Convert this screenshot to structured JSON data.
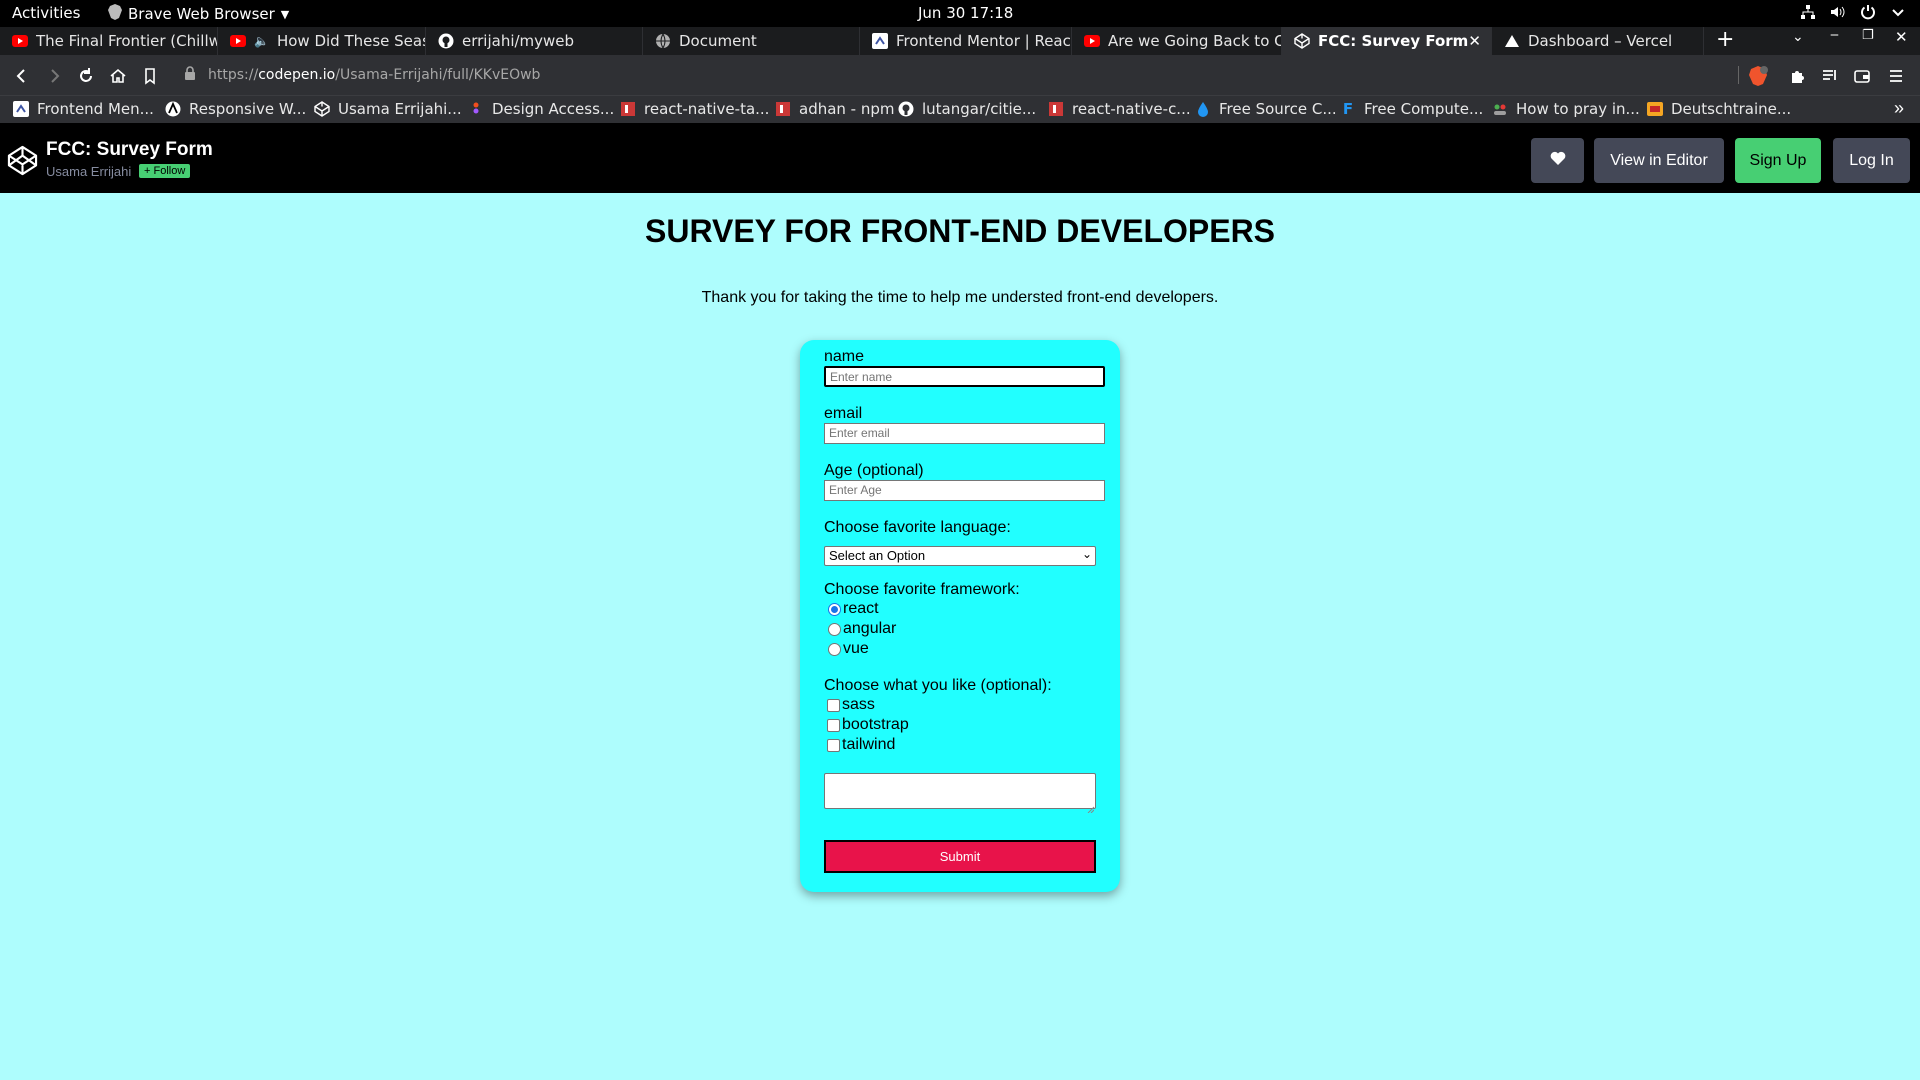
{
  "system_bar": {
    "activities": "Activities",
    "app_name": "Brave Web Browser",
    "clock": "Jun 30  17:18"
  },
  "tabs": [
    {
      "title": "The Final Frontier (Chillwa",
      "icon": "youtube-icon"
    },
    {
      "title": "How Did These Seashel",
      "icon": "youtube-icon"
    },
    {
      "title": "errijahi/myweb",
      "icon": "github-icon"
    },
    {
      "title": "Document",
      "icon": "globe-icon"
    },
    {
      "title": "Frontend Mentor | React c",
      "icon": "frontend-mentor-icon"
    },
    {
      "title": "Are we Going Back to Chin",
      "icon": "youtube-icon"
    },
    {
      "title": "FCC: Survey Form",
      "icon": "codepen-icon",
      "active": true
    },
    {
      "title": "Dashboard – Vercel",
      "icon": "vercel-icon"
    }
  ],
  "address_bar": {
    "url_prefix": "https://",
    "url_domain": "codepen.io",
    "url_path": "/Usama-Errijahi/full/KKvEOwb"
  },
  "bookmarks": [
    {
      "label": "Frontend Men...",
      "icon": "frontend-mentor-icon"
    },
    {
      "label": "Responsive W...",
      "icon": "astro-icon"
    },
    {
      "label": "Usama Errijahi...",
      "icon": "codepen-icon"
    },
    {
      "label": "Design Access...",
      "icon": "figma-icon"
    },
    {
      "label": "react-native-ta...",
      "icon": "npm-icon"
    },
    {
      "label": "adhan - npm",
      "icon": "npm-icon"
    },
    {
      "label": "lutangar/citie...",
      "icon": "github-icon"
    },
    {
      "label": "react-native-c...",
      "icon": "npm-icon"
    },
    {
      "label": "Free Source C...",
      "icon": "drop-icon"
    },
    {
      "label": "Free Compute...",
      "icon": "f-icon"
    },
    {
      "label": "How to pray in...",
      "icon": "people-icon"
    },
    {
      "label": "Deutschtraine...",
      "icon": "deutsch-icon"
    }
  ],
  "codepen": {
    "pen_title": "FCC: Survey Form",
    "author": "Usama Errijahi",
    "follow": "+ Follow",
    "view_in_editor": "View in Editor",
    "sign_up": "Sign Up",
    "log_in": "Log In"
  },
  "survey": {
    "title": "SURVEY FOR FRONT-END DEVELOPERS",
    "description": "Thank you for taking the time to help me understed front-end developers.",
    "name_label": "name",
    "name_placeholder": "Enter name",
    "email_label": "email",
    "email_placeholder": "Enter email",
    "age_label": "Age (optional)",
    "age_placeholder": "Enter Age",
    "language_label": "Choose favorite language:",
    "language_selected": "Select an Option",
    "framework_label": "Choose favorite framework:",
    "frameworks": [
      {
        "label": "react",
        "checked": true
      },
      {
        "label": "angular",
        "checked": false
      },
      {
        "label": "vue",
        "checked": false
      }
    ],
    "likes_label": "Choose what you like (optional):",
    "likes": [
      {
        "label": "sass",
        "checked": false
      },
      {
        "label": "bootstrap",
        "checked": false
      },
      {
        "label": "tailwind",
        "checked": false
      }
    ],
    "submit": "Submit"
  },
  "colors": {
    "page_background": "#aefdfd",
    "form_background": "#21ffff",
    "submit_background": "#e8134a",
    "codepen_green": "#47cf73"
  }
}
